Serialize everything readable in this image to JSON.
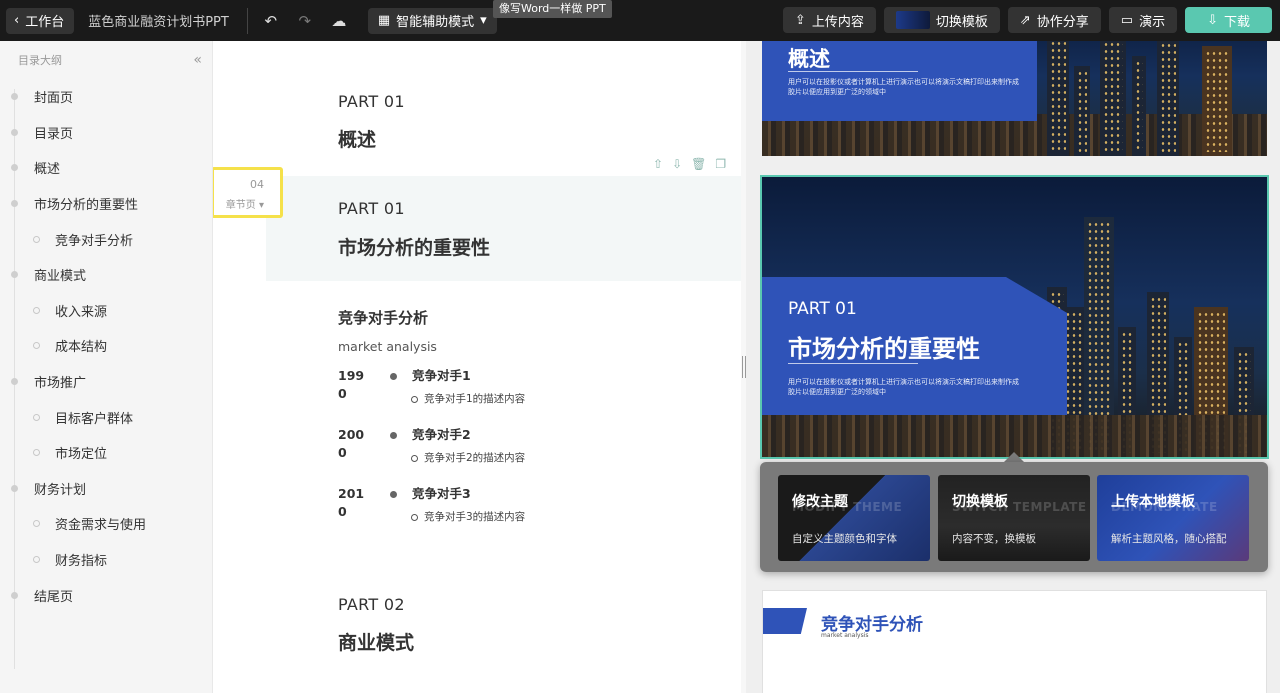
{
  "topbar": {
    "back_label": "工作台",
    "doc_title": "蓝色商业融资计划书PPT",
    "mode_label": "智能辅助模式",
    "tooltip": "像写Word一样做 PPT",
    "upload_label": "上传内容",
    "switch_template_label": "切换模板",
    "share_label": "协作分享",
    "present_label": "演示",
    "download_label": "下载"
  },
  "outline": {
    "header": "目录大纲",
    "items": [
      {
        "label": "封面页",
        "level": 1
      },
      {
        "label": "目录页",
        "level": 1
      },
      {
        "label": "概述",
        "level": 1
      },
      {
        "label": "市场分析的重要性",
        "level": 1
      },
      {
        "label": "竞争对手分析",
        "level": 2
      },
      {
        "label": "商业模式",
        "level": 1
      },
      {
        "label": "收入来源",
        "level": 2
      },
      {
        "label": "成本结构",
        "level": 2
      },
      {
        "label": "市场推广",
        "level": 1
      },
      {
        "label": "目标客户群体",
        "level": 2
      },
      {
        "label": "市场定位",
        "level": 2
      },
      {
        "label": "财务计划",
        "level": 1
      },
      {
        "label": "资金需求与使用",
        "level": 2
      },
      {
        "label": "财务指标",
        "level": 2
      },
      {
        "label": "结尾页",
        "level": 1
      }
    ]
  },
  "editor": {
    "sec1": {
      "part": "PART 01",
      "title": "概述"
    },
    "sec2": {
      "part": "PART 01",
      "title": "市场分析的重要性",
      "page_num": "04",
      "page_type": "章节页"
    },
    "competitors": {
      "title": "竞争对手分析",
      "subtitle": "market analysis",
      "rows": [
        {
          "year": "1990",
          "name": "竞争对手1",
          "desc": "竞争对手1的描述内容"
        },
        {
          "year": "2000",
          "name": "竞争对手2",
          "desc": "竞争对手2的描述内容"
        },
        {
          "year": "2010",
          "name": "竞争对手3",
          "desc": "竞争对手3的描述内容"
        }
      ]
    },
    "sec4": {
      "part": "PART 02",
      "title": "商业模式"
    }
  },
  "preview": {
    "slide1": {
      "title": "概述",
      "desc": "用户可以在投影仪或者计算机上进行演示也可以将演示文稿打印出来制作成胶片以便应用到更广泛的领域中"
    },
    "slide2": {
      "part": "PART 01",
      "title": "市场分析的重要性",
      "desc": "用户可以在投影仪或者计算机上进行演示也可以将演示文稿打印出来制作成胶片以便应用到更广泛的领域中"
    },
    "popup": [
      {
        "title": "修改主题",
        "ghost": "MODIFY THEME",
        "sub": "自定义主题颜色和字体"
      },
      {
        "title": "切换模板",
        "ghost": "SWITCH TEMPLATE",
        "sub": "内容不变，换模板"
      },
      {
        "title": "上传本地模板",
        "ghost": "DEMONSTRATE",
        "sub": "解析主题风格，随心搭配"
      }
    ],
    "slide3": {
      "title": "竞争对手分析",
      "subtitle": "market analysis"
    }
  },
  "colors": {
    "accent": "#5ac8b0",
    "brand_blue": "#2f53b8",
    "highlight": "#f5e14a"
  }
}
